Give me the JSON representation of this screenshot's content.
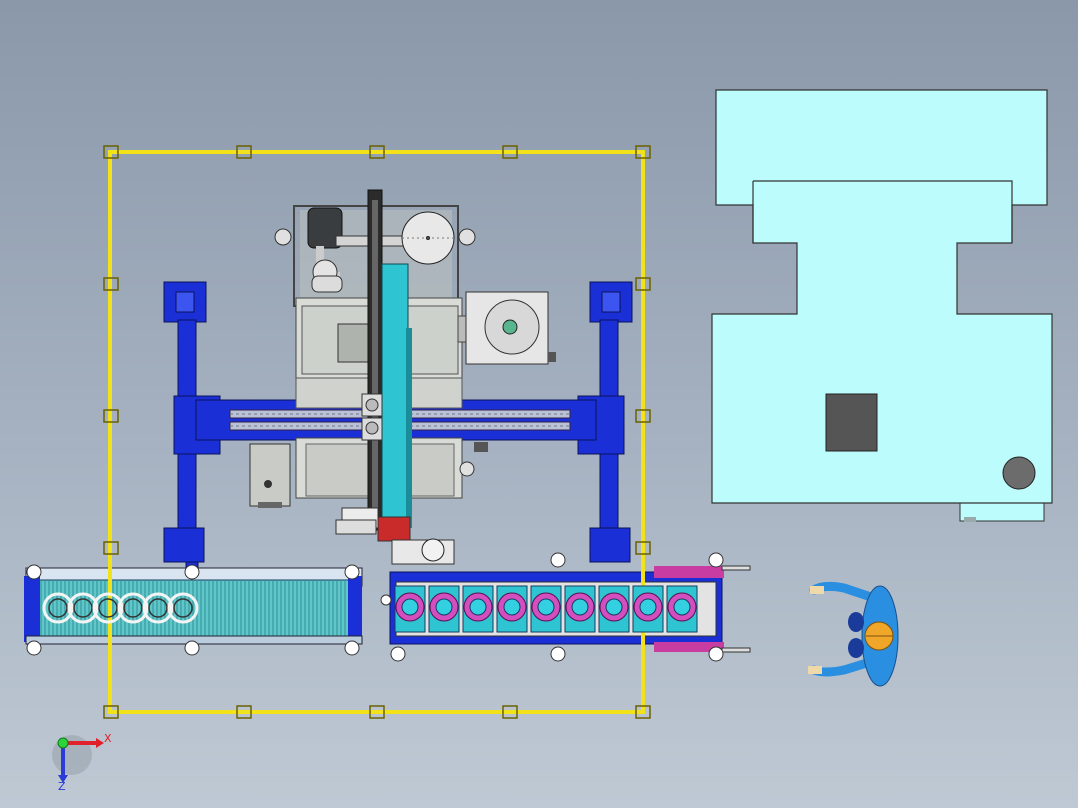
{
  "title": "",
  "colors": {
    "background_top": "#8a98aa",
    "background_bottom": "#bfc9d4",
    "guard_rail": "#f2e21a",
    "frame_blue": "#1a2fd6",
    "cyan_body": "#bdfcfc",
    "conveyor_teal": "#5fc7c9",
    "machine_grey": "#d9dcd6",
    "operator_blue": "#2a8fe0"
  },
  "icons": {
    "triad": "coordinate-triad-icon",
    "operator": "operator-figure-icon",
    "motor": "servo-motor-icon"
  },
  "triad": {
    "x_label": "X",
    "z_label": "Z"
  }
}
